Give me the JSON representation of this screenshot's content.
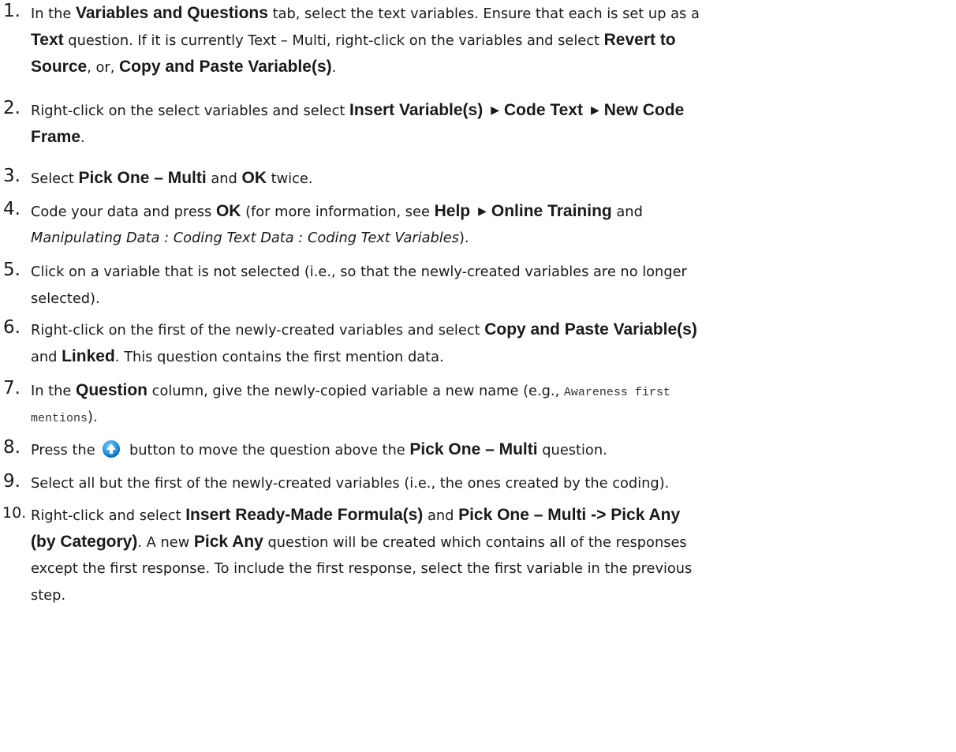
{
  "steps": [
    {
      "num": "1.",
      "lines": [
        [
          {
            "t": "In the "
          },
          {
            "t": "Variables and Questions",
            "b": true
          },
          {
            "t": " tab, select the text variables.  Ensure that each is set up as a"
          }
        ],
        [
          {
            "t": "Text",
            "b": true
          },
          {
            "t": " question.  If it is currently Text – Multi, right-click on the variables and select "
          },
          {
            "t": "Revert to",
            "b": true
          }
        ],
        [
          {
            "t": "Source",
            "b": true
          },
          {
            "t": ", or, "
          },
          {
            "t": "Copy and Paste Variable(s)",
            "b": true
          },
          {
            "t": "."
          }
        ]
      ]
    },
    {
      "num": "2.",
      "lines": [
        [
          {
            "t": "Right-click on the select variables and select "
          },
          {
            "t": "Insert Variable(s)",
            "b": true
          },
          {
            "t": "▶",
            "arrow": true
          },
          {
            "t": "Code Text",
            "b": true
          },
          {
            "t": "▶",
            "arrow": true
          },
          {
            "t": "New Code",
            "b": true
          }
        ],
        [
          {
            "t": "Frame",
            "b": true
          },
          {
            "t": "."
          }
        ]
      ]
    },
    {
      "num": "3.",
      "lines": [
        [
          {
            "t": "Select "
          },
          {
            "t": "Pick One – Multi",
            "b": true
          },
          {
            "t": " and "
          },
          {
            "t": "OK",
            "b": true
          },
          {
            "t": " twice."
          }
        ]
      ]
    },
    {
      "num": "4.",
      "lines": [
        [
          {
            "t": "Code your data and press "
          },
          {
            "t": "OK",
            "b": true
          },
          {
            "t": " (for more information, see "
          },
          {
            "t": "Help",
            "b": true
          },
          {
            "t": "▶",
            "arrow": true
          },
          {
            "t": "Online Training",
            "b": true
          },
          {
            "t": "  and"
          }
        ],
        [
          {
            "t": "Manipulating Data : Coding Text Data : Coding Text Variables",
            "i": true
          },
          {
            "t": ")."
          }
        ]
      ]
    },
    {
      "num": "5.",
      "lines": [
        [
          {
            "t": "Click on a variable that is not selected (i.e., so that the newly-created variables are no longer"
          }
        ],
        [
          {
            "t": "selected)."
          }
        ]
      ]
    },
    {
      "num": "6.",
      "lines": [
        [
          {
            "t": "Right-click on the first of the newly-created variables and select "
          },
          {
            "t": "Copy and Paste Variable(s)",
            "b": true
          }
        ],
        [
          {
            "t": "and "
          },
          {
            "t": "Linked",
            "b": true
          },
          {
            "t": ".  This question contains the first mention data."
          }
        ]
      ]
    },
    {
      "num": "7.",
      "lines": [
        [
          {
            "t": "In the "
          },
          {
            "t": "Question",
            "b": true
          },
          {
            "t": " column, give the newly-copied variable a new name (e.g., "
          },
          {
            "t": "Awareness first",
            "m": true
          }
        ],
        [
          {
            "t": "mentions",
            "m": true
          },
          {
            "t": ")."
          }
        ]
      ]
    },
    {
      "num": "8.",
      "lines": [
        [
          {
            "t": "Press the "
          },
          {
            "icon": "move-up-icon"
          },
          {
            "t": " button to move the question above the "
          },
          {
            "t": "Pick One – Multi",
            "b": true
          },
          {
            "t": " question."
          }
        ]
      ]
    },
    {
      "num": "9.",
      "lines": [
        [
          {
            "t": "Select all but the first of the newly-created variables (i.e., the ones created by the coding)."
          }
        ]
      ]
    },
    {
      "num": "10.",
      "lines": [
        [
          {
            "t": "Right-click and select "
          },
          {
            "t": "Insert Ready-Made Formula(s)",
            "b": true
          },
          {
            "t": " and "
          },
          {
            "t": "Pick One – Multi -> Pick Any",
            "b": true
          }
        ],
        [
          {
            "t": "(by Category)",
            "b": true
          },
          {
            "t": ".  A new "
          },
          {
            "t": "Pick Any",
            "b": true
          },
          {
            "t": " question will be created which contains all of the responses"
          }
        ],
        [
          {
            "t": "except the first response.  To include the first response, select the first variable in the previous"
          }
        ],
        [
          {
            "t": "step."
          }
        ]
      ]
    }
  ]
}
